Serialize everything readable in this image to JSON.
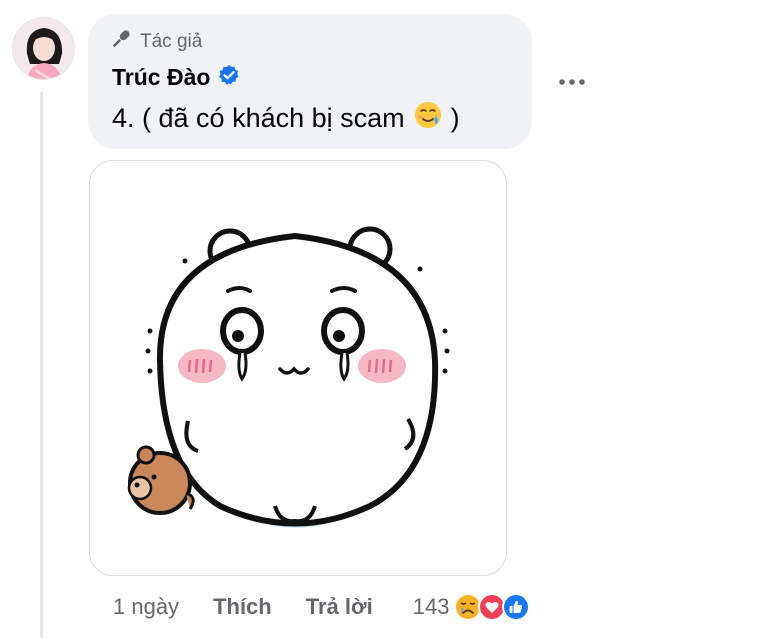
{
  "comment": {
    "author_badge": "Tác giả",
    "author_name": "Trúc Đào",
    "text": "4. ( đã có khách bị scam",
    "text_close": ")",
    "emoji_icon": "crying-smile-emoji-icon",
    "verified_icon": "verified-badge-icon",
    "sticker": "crying-white-bear-sticker"
  },
  "actions": {
    "time": "1 ngày",
    "like_label": "Thích",
    "reply_label": "Trả lời",
    "reaction_count": "143",
    "reactions": [
      "sad-reaction-icon",
      "love-reaction-icon",
      "like-reaction-icon"
    ]
  },
  "colors": {
    "bubble_bg": "#f0f2f5",
    "secondary_text": "#65676b",
    "verified_blue": "#1877f2",
    "love_red": "#f33e58",
    "sad_yellow": "#f7b125"
  }
}
